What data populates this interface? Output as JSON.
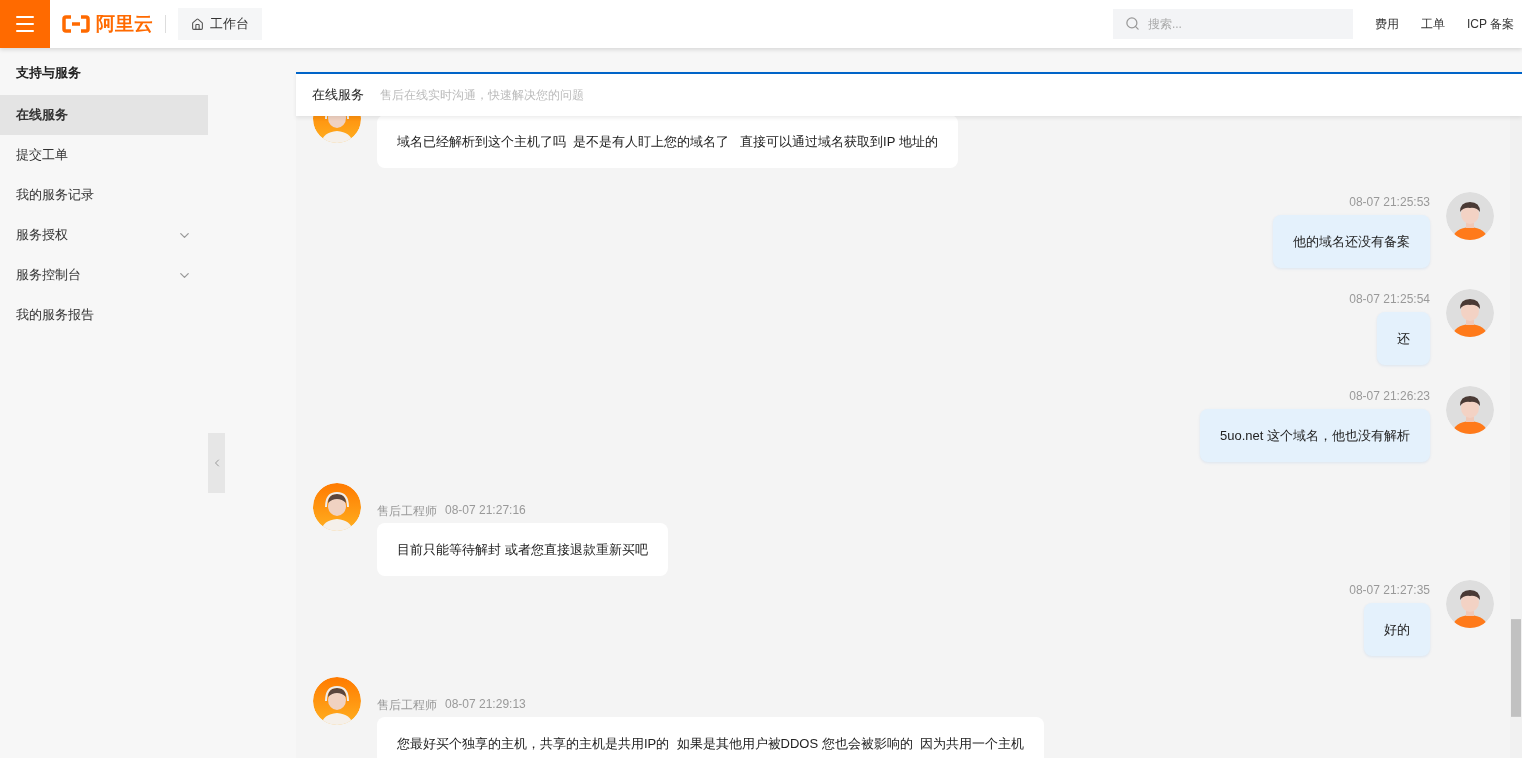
{
  "topbar": {
    "logo": "阿里云",
    "workbench": "工作台",
    "search": {
      "placeholder": "搜索..."
    },
    "links": [
      "费用",
      "工单",
      "ICP 备案"
    ]
  },
  "sidebar": {
    "title": "支持与服务",
    "items": [
      {
        "label": "在线服务",
        "selected": true,
        "kind": "link"
      },
      {
        "label": "提交工单",
        "selected": false,
        "kind": "link"
      },
      {
        "label": "我的服务记录",
        "selected": false,
        "kind": "link"
      },
      {
        "label": "服务授权",
        "selected": false,
        "kind": "group"
      },
      {
        "label": "服务控制台",
        "selected": false,
        "kind": "group"
      },
      {
        "label": "我的服务报告",
        "selected": false,
        "kind": "link"
      }
    ]
  },
  "panel": {
    "title": "在线服务",
    "subtitle": "售后在线实时沟通，快速解决您的问题"
  },
  "messages": [
    {
      "kind": "agent",
      "text": "域名已经解析到这个主机了吗  是不是有人盯上您的域名了   直接可以通过域名获取到IP 地址的"
    },
    {
      "kind": "user",
      "time": "08-07 21:25:53",
      "text": "他的域名还没有备案"
    },
    {
      "kind": "user",
      "time": "08-07 21:25:54",
      "text": "还"
    },
    {
      "kind": "user",
      "time": "08-07 21:26:23",
      "text": "5uo.net 这个域名，他也没有解析"
    },
    {
      "kind": "agent",
      "sender": "售后工程师",
      "time": "08-07 21:27:16",
      "text": "目前只能等待解封 或者您直接退款重新买吧"
    },
    {
      "kind": "user",
      "time": "08-07 21:27:35",
      "text": "好的"
    },
    {
      "kind": "agent",
      "sender": "售后工程师",
      "time": "08-07 21:29:13",
      "text": "您最好买个独享的主机，共享的主机是共用IP的  如果是其他用户被DDOS 您也会被影响的  因为共用一个主机"
    }
  ]
}
